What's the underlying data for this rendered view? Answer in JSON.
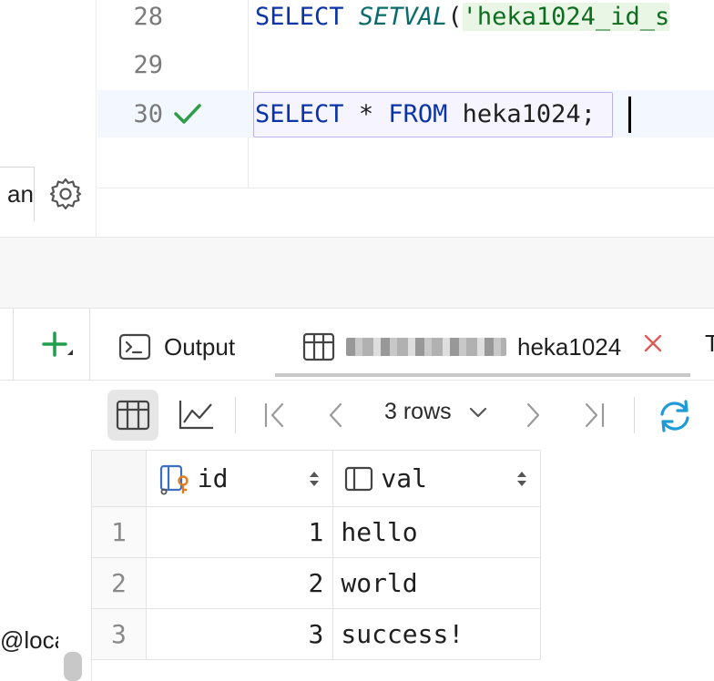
{
  "editor": {
    "lines": [
      {
        "number": "28",
        "kw": "SELECT",
        "fn": "SETVAL",
        "paren": "(",
        "quote": "'",
        "str": "heka1024_id_s"
      },
      {
        "number": "29"
      },
      {
        "number": "30",
        "kw1": "SELECT",
        "star": "*",
        "kw2": "FROM",
        "ident": "heka1024",
        "semi": ";",
        "status": "check-icon"
      }
    ]
  },
  "left_panel": {
    "input_text": "an",
    "bottom_text": "@loca"
  },
  "tool_window": {
    "add_label": "+",
    "tabs": [
      {
        "label": "Output",
        "icon": "console-icon"
      },
      {
        "label": "heka1024",
        "icon": "table-icon",
        "active": true,
        "closable": true
      }
    ],
    "next_tab_label": "T"
  },
  "results_toolbar": {
    "rows_label": "3 rows"
  },
  "grid": {
    "columns": [
      {
        "name": "id",
        "icon": "key-column-icon"
      },
      {
        "name": "val",
        "icon": "column-icon"
      }
    ],
    "rows": [
      {
        "num": "1",
        "id": "1",
        "val": "hello"
      },
      {
        "num": "2",
        "id": "2",
        "val": "world"
      },
      {
        "num": "3",
        "id": "3",
        "val": "success!"
      }
    ]
  },
  "colors": {
    "keyword": "#0a33a8",
    "string": "#0f6d1f",
    "success": "#2e9e48",
    "close": "#e05a5a",
    "refresh": "#1e9ad6",
    "add": "#1f9e4c"
  }
}
